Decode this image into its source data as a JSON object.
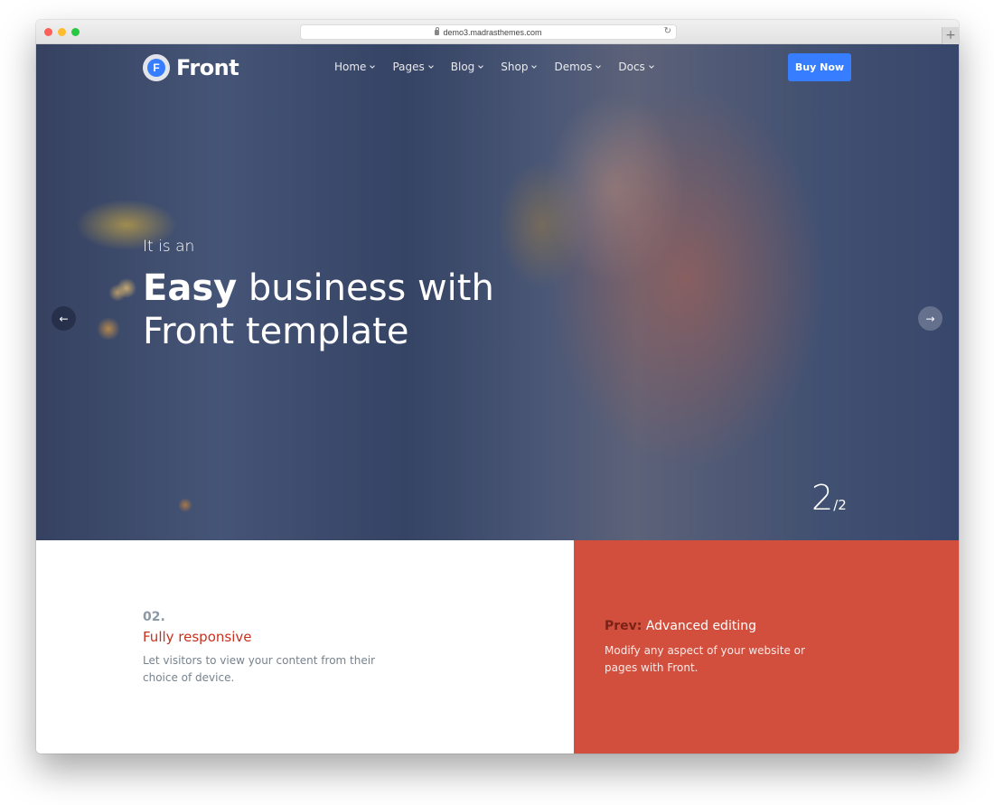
{
  "browser": {
    "url": "demo3.madrasthemes.com",
    "new_tab_label": "+"
  },
  "header": {
    "logo_letter": "F",
    "logo_text": "Front",
    "nav": [
      {
        "label": "Home"
      },
      {
        "label": "Pages"
      },
      {
        "label": "Blog"
      },
      {
        "label": "Shop"
      },
      {
        "label": "Demos"
      },
      {
        "label": "Docs"
      }
    ],
    "cta_label": "Buy Now"
  },
  "hero": {
    "kicker": "It is an",
    "title_bold": "Easy",
    "title_rest": " business with",
    "title_line2": "Front template",
    "slide_current": "2",
    "slide_total": "/2",
    "prev_arrow": "←",
    "next_arrow": "→"
  },
  "feature": {
    "number": "02.",
    "title": "Fully responsive",
    "description": "Let visitors to view your content from their choice of device."
  },
  "prev_feature": {
    "label": "Prev:",
    "title": " Advanced editing",
    "description": "Modify any aspect of your website or pages with Front."
  },
  "colors": {
    "primary": "#377dff",
    "accent": "#d34f3d",
    "feature_title": "#c9311f"
  }
}
